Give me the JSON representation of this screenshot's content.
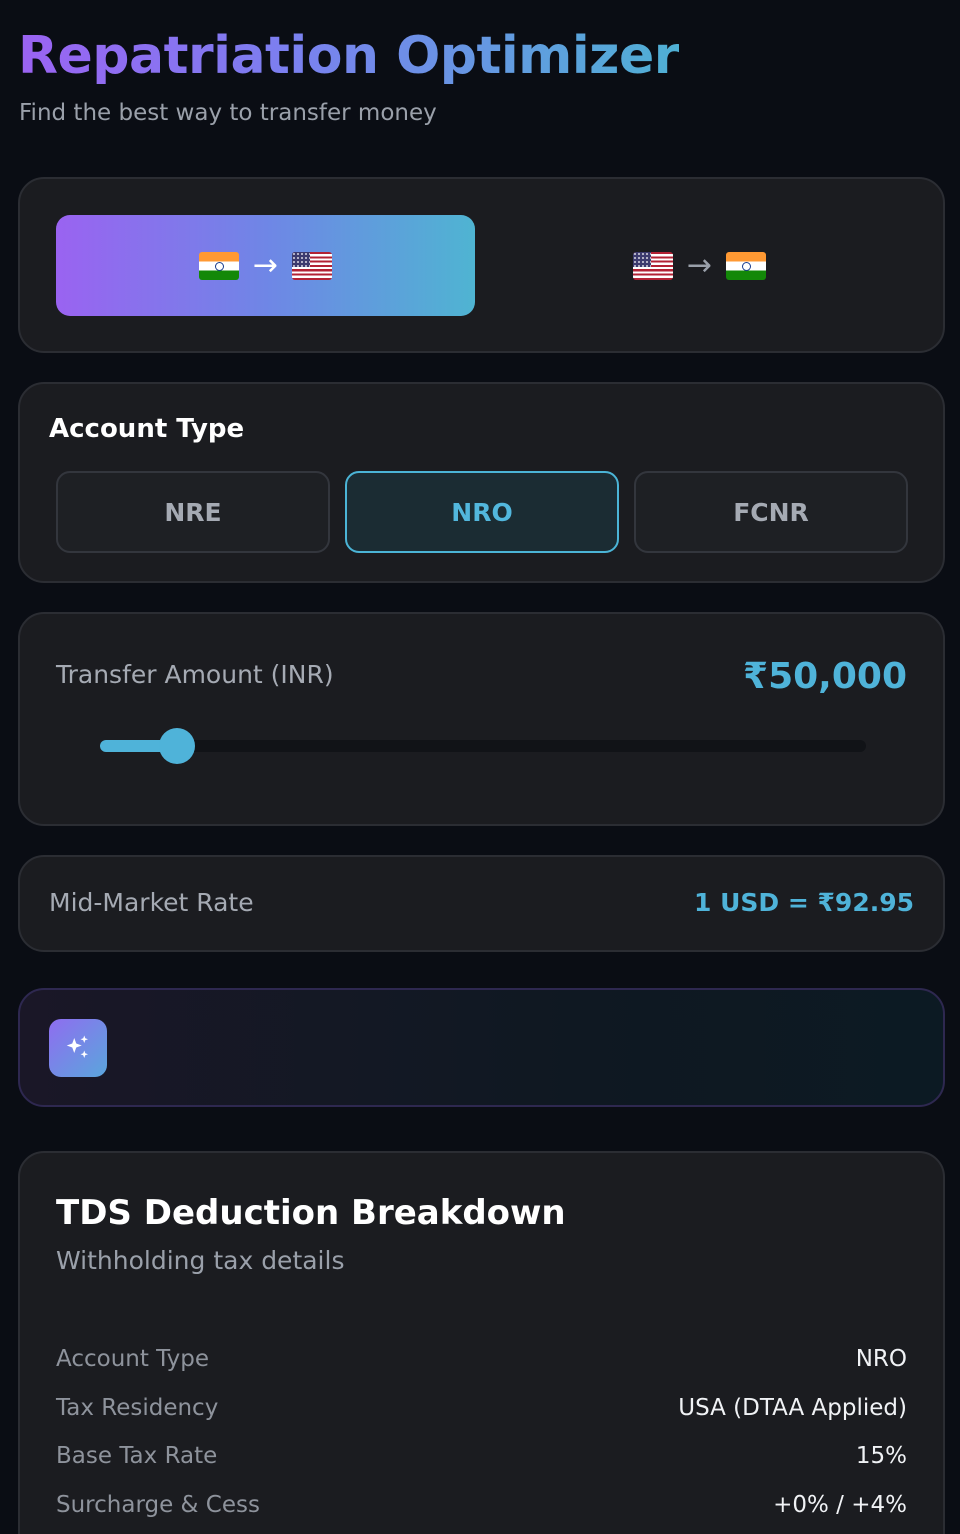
{
  "header": {
    "title": "Repatriation Optimizer",
    "subtitle": "Find the best way to transfer money"
  },
  "direction": {
    "arrow": "→",
    "options": [
      {
        "from": "india-flag-icon",
        "to": "usa-flag-icon",
        "active": true
      },
      {
        "from": "usa-flag-icon",
        "to": "india-flag-icon",
        "active": false
      }
    ]
  },
  "account_type": {
    "label": "Account Type",
    "options": [
      "NRE",
      "NRO",
      "FCNR"
    ],
    "selected": "NRO"
  },
  "transfer": {
    "label": "Transfer Amount (INR)",
    "value": "₹50,000",
    "slider_fraction": 0.1
  },
  "rate": {
    "label": "Mid-Market Rate",
    "value": "1 USD = ₹92.95"
  },
  "insight": {
    "icon": "sparkles-icon"
  },
  "tds": {
    "title": "TDS Deduction Breakdown",
    "subtitle": "Withholding tax details",
    "rows": [
      {
        "key": "Account Type",
        "value": "NRO"
      },
      {
        "key": "Tax Residency",
        "value": "USA (DTAA Applied)"
      },
      {
        "key": "Base Tax Rate",
        "value": "15%"
      },
      {
        "key": "Surcharge & Cess",
        "value": "+0% / +4%"
      }
    ]
  },
  "colors": {
    "accent": "#4fb3d9",
    "gradient_start": "#9a63f1",
    "gradient_end": "#4fb4d2",
    "background": "#0a0d14",
    "card": "#1b1c20"
  }
}
